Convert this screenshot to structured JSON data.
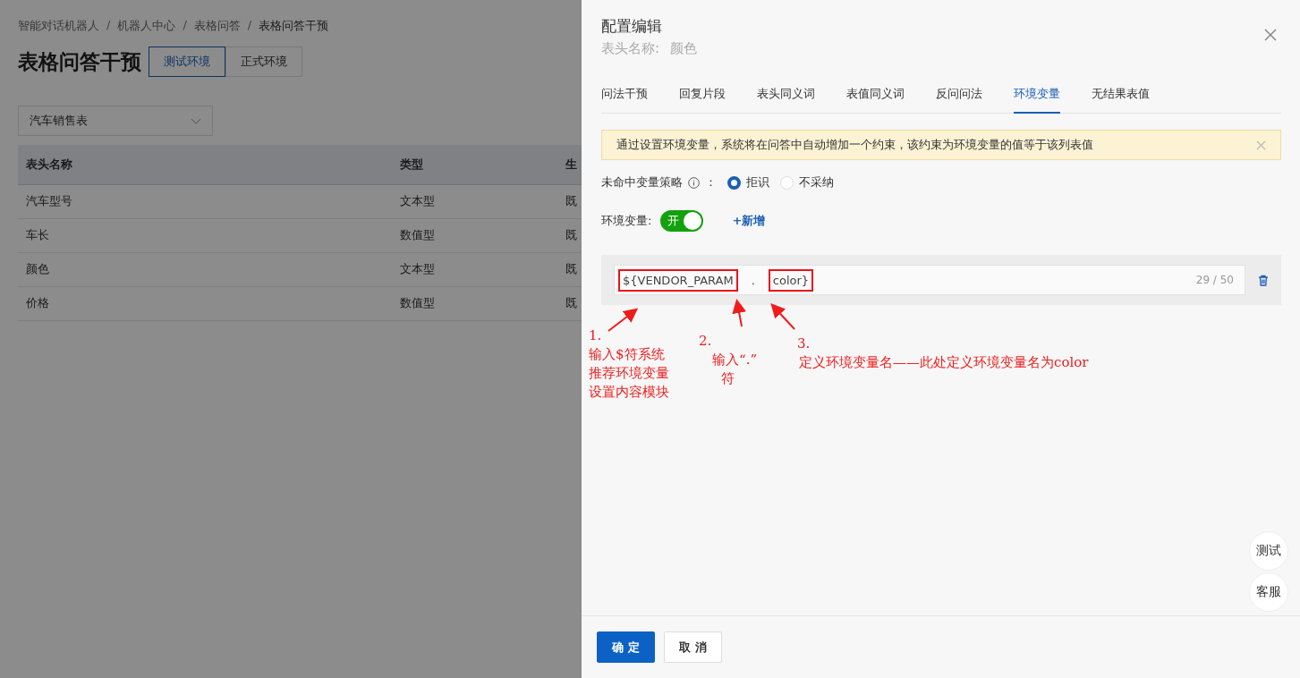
{
  "breadcrumb": [
    "智能对话机器人",
    "机器人中心",
    "表格问答",
    "表格问答干预"
  ],
  "breadcrumb_separator": "/",
  "page_title": "表格问答干预",
  "env_tabs": [
    {
      "label": "测试环境",
      "selected": true
    },
    {
      "label": "正式环境",
      "selected": false
    }
  ],
  "table_select": {
    "value": "汽车销售表"
  },
  "table": {
    "columns": [
      "表头名称",
      "类型",
      "生"
    ],
    "rows": [
      [
        "汽车型号",
        "文本型",
        "既"
      ],
      [
        "车长",
        "数值型",
        "既"
      ],
      [
        "颜色",
        "文本型",
        "既"
      ],
      [
        "价格",
        "数值型",
        "既"
      ]
    ]
  },
  "drawer": {
    "title": "配置编辑",
    "subtitle_label": "表头名称:",
    "subtitle_value": "颜色",
    "tabs": [
      {
        "label": "问法干预",
        "selected": false
      },
      {
        "label": "回复片段",
        "selected": false
      },
      {
        "label": "表头同义词",
        "selected": false
      },
      {
        "label": "表值同义词",
        "selected": false
      },
      {
        "label": "反问问法",
        "selected": false
      },
      {
        "label": "环境变量",
        "selected": true
      },
      {
        "label": "无结果表值",
        "selected": false
      }
    ],
    "notice": "通过设置环境变量，系统将在问答中自动增加一个约束，该约束为环境变量的值等于该列表值",
    "strategy": {
      "label": "未命中变量策略",
      "colon": "：",
      "options": [
        {
          "label": "拒识",
          "selected": true
        },
        {
          "label": "不采纳",
          "selected": false
        }
      ]
    },
    "env_switch": {
      "label": "环境变量:",
      "on": true,
      "on_text": "开"
    },
    "add_link": "+新增",
    "variable": {
      "tokens": [
        {
          "text": "${VENDOR_PARAM",
          "boxed": true
        },
        {
          "text": ".",
          "boxed": false
        },
        {
          "text": "color}",
          "boxed": true
        }
      ],
      "counter": "29 / 50"
    },
    "annotations": [
      {
        "number": "1.",
        "lines": [
          "输入$符系统",
          "推荐环境变量",
          "设置内容模块"
        ]
      },
      {
        "number": "2.",
        "lines": [
          "输入“.”",
          "符"
        ]
      },
      {
        "number": "3.",
        "lines": [
          "定义环境变量名——此处定义环境变量名为color"
        ]
      }
    ],
    "float_buttons": [
      "测试",
      "客服"
    ],
    "buttons": [
      {
        "label": "确 定",
        "primary": true
      },
      {
        "label": "取 消",
        "primary": false
      }
    ]
  }
}
